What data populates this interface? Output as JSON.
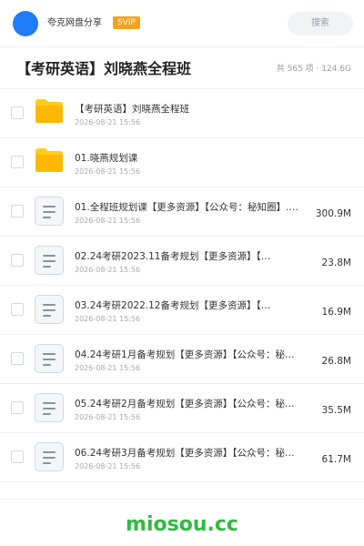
{
  "header": {
    "app_name": "夸克网盘分享",
    "vip_badge": "SVIP",
    "search_label": "搜索"
  },
  "title_bar": {
    "title": "【考研英语】刘晓燕全程班",
    "summary": "共 565 项 · 124.6G"
  },
  "colors": {
    "avatar": "#1f7bf6",
    "vip_badge": "#f5a223",
    "folder": "#ffcc1a",
    "watermark": "#2fbb3f"
  },
  "files": [
    {
      "type": "folder",
      "icon": "folder-icon",
      "name": "【考研英语】刘晓燕全程班",
      "date": "2026-08-21 15:56",
      "size": ""
    },
    {
      "type": "folder",
      "icon": "folder-icon",
      "name": "01.晓燕规划课",
      "date": "2026-08-21 15:56",
      "size": ""
    },
    {
      "type": "file",
      "icon": "document-icon",
      "name": "01.全程班规划课【更多资源】【公众号：秘知圈】.…",
      "date": "2026-08-21 15:56",
      "size": "300.9M"
    },
    {
      "type": "file",
      "icon": "document-icon",
      "name": "02.24考研2023.11备考规划【更多资源】【…",
      "date": "2026-08-21 15:56",
      "size": "23.8M"
    },
    {
      "type": "file",
      "icon": "document-icon",
      "name": "03.24考研2022.12备考规划【更多资源】【…",
      "date": "2026-08-21 15:56",
      "size": "16.9M"
    },
    {
      "type": "file",
      "icon": "document-icon",
      "name": "04.24考研1月备考规划【更多资源】【公众号：秘…",
      "date": "2026-08-21 15:56",
      "size": "26.8M"
    },
    {
      "type": "file",
      "icon": "document-icon",
      "name": "05.24考研2月备考规划【更多资源】【公众号：秘…",
      "date": "2026-08-21 15:56",
      "size": "35.5M"
    },
    {
      "type": "file",
      "icon": "document-icon",
      "name": "06.24考研3月备考规划【更多资源】【公众号：秘…",
      "date": "2026-08-21 15:56",
      "size": "61.7M"
    }
  ],
  "footer": {
    "watermark": "miosou.cc"
  }
}
